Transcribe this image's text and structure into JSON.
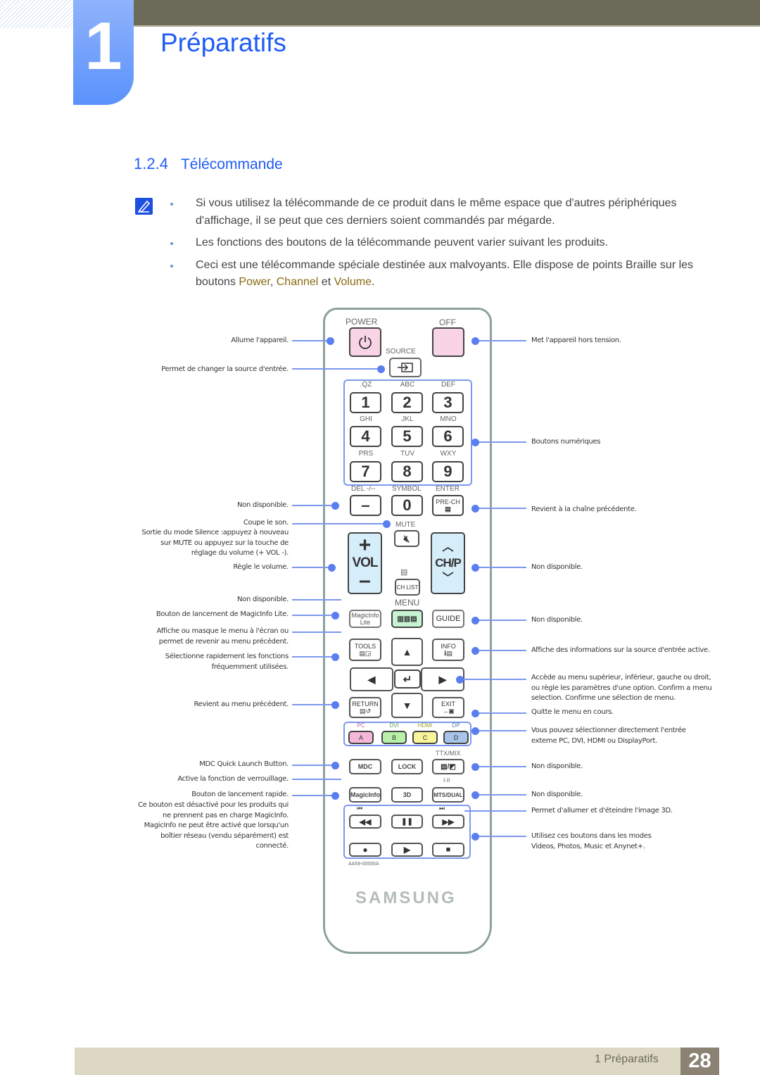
{
  "chapter": {
    "number": "1",
    "title": "Préparatifs"
  },
  "section": {
    "number": "1.2.4",
    "title": "Télécommande"
  },
  "notes": [
    {
      "text": "Si vous utilisez la télécommande de ce produit dans le même espace que d'autres périphériques d'affichage, il se peut que ces derniers soient commandés par mégarde."
    },
    {
      "text": "Les fonctions des boutons de la télécommande peuvent varier suivant les produits."
    },
    {
      "text_before": "Ceci est une télécommande spéciale destinée aux malvoyants. Elle dispose de points Braille sur les boutons ",
      "power": "Power",
      "sep1": ", ",
      "channel": "Channel",
      "sep2": " et ",
      "volume": "Volume",
      "end": "."
    }
  ],
  "remote": {
    "power_label": "POWER",
    "off_label": "OFF",
    "source_label": "SOURCE",
    "keypad": [
      {
        "letters": ".QZ",
        "digit": "1"
      },
      {
        "letters": "ABC",
        "digit": "2"
      },
      {
        "letters": "DEF",
        "digit": "3"
      },
      {
        "letters": "GHI",
        "digit": "4"
      },
      {
        "letters": "JKL",
        "digit": "5"
      },
      {
        "letters": "MNO",
        "digit": "6"
      },
      {
        "letters": "PRS",
        "digit": "7"
      },
      {
        "letters": "TUV",
        "digit": "8"
      },
      {
        "letters": "WXY",
        "digit": "9"
      }
    ],
    "del_label": "DEL -/--",
    "symbol_label": "SYMBOL",
    "enter_label": "ENTER",
    "dash_key": "–",
    "zero_key": "0",
    "prech_label": "PRE-CH",
    "mute_label": "MUTE",
    "vol_label": "VOL",
    "vol_plus": "+",
    "vol_minus": "–",
    "chp_label": "CH/P",
    "chlist_label": "CH LIST",
    "menu_label": "MENU",
    "magicinfo_lite": "MagicInfo Lite",
    "guide_label": "GUIDE",
    "tools_label": "TOOLS",
    "info_label": "INFO",
    "return_label": "RETURN",
    "exit_label": "EXIT",
    "color_keys": [
      {
        "source": "PC",
        "key": "A",
        "color": "#f6b8d8"
      },
      {
        "source": "DVI",
        "key": "B",
        "color": "#b8f0a8"
      },
      {
        "source": "HDMI",
        "key": "C",
        "color": "#f8f49a"
      },
      {
        "source": "DP",
        "key": "D",
        "color": "#a8c4e8"
      }
    ],
    "ttx_label": "TTX/MIX",
    "mdc_label": "MDC",
    "lock_label": "LOCK",
    "i_ii_label": "I-II",
    "magicinfo_label": "MagicInfo",
    "threed_label": "3D",
    "mts_label": "MTS/DUAL",
    "model": "AA59-00555A",
    "brand": "SAMSUNG"
  },
  "callouts_left": [
    "Allume l'appareil.",
    "Permet de changer la source d'entrée.",
    "Non disponible.",
    "Coupe le son.",
    "Sortie du mode Silence :appuyez à nouveau sur MUTE ou appuyez sur la touche de réglage du volume (+ VOL -).",
    "Règle le volume.",
    "Non disponible.",
    "Bouton de lancement de MagicInfo Lite.",
    "Affiche ou masque le menu à l'écran ou permet de revenir au menu précédent.",
    "Sélectionne rapidement les fonctions fréquemment utilisées.",
    "Revient au menu précédent.",
    "MDC Quick Launch Button.",
    "Active la fonction de verrouillage.",
    "Bouton de lancement rapide.",
    "Ce bouton est désactivé pour les produits qui ne prennent pas en charge MagicInfo. MagicInfo ne peut être activé que lorsqu'un boîtier réseau (vendu séparément) est connecté."
  ],
  "callouts_right": [
    "Met l'appareil hors tension.",
    "Boutons numériques",
    "Revient à la chaîne précédente.",
    "Non disponible.",
    "Non disponible.",
    "Affiche des informations sur la source d'entrée active.",
    "Accède au menu supérieur, inférieur, gauche ou droit, ou règle les paramètres d'une option. Confirm a menu selection. Confirme une sélection de menu.",
    "Quitte le menu en cours.",
    "Vous pouvez sélectionner directement l'entrée externe PC, DVI, HDMI ou DisplayPort.",
    "Non disponible.",
    "Non disponible.",
    "Permet d'allumer et d'éteindre l'image 3D.",
    "Utilisez ces boutons dans les modes Videos, Photos, Music et Anynet+."
  ],
  "footer": {
    "label": "1 Préparatifs",
    "page": "28"
  }
}
